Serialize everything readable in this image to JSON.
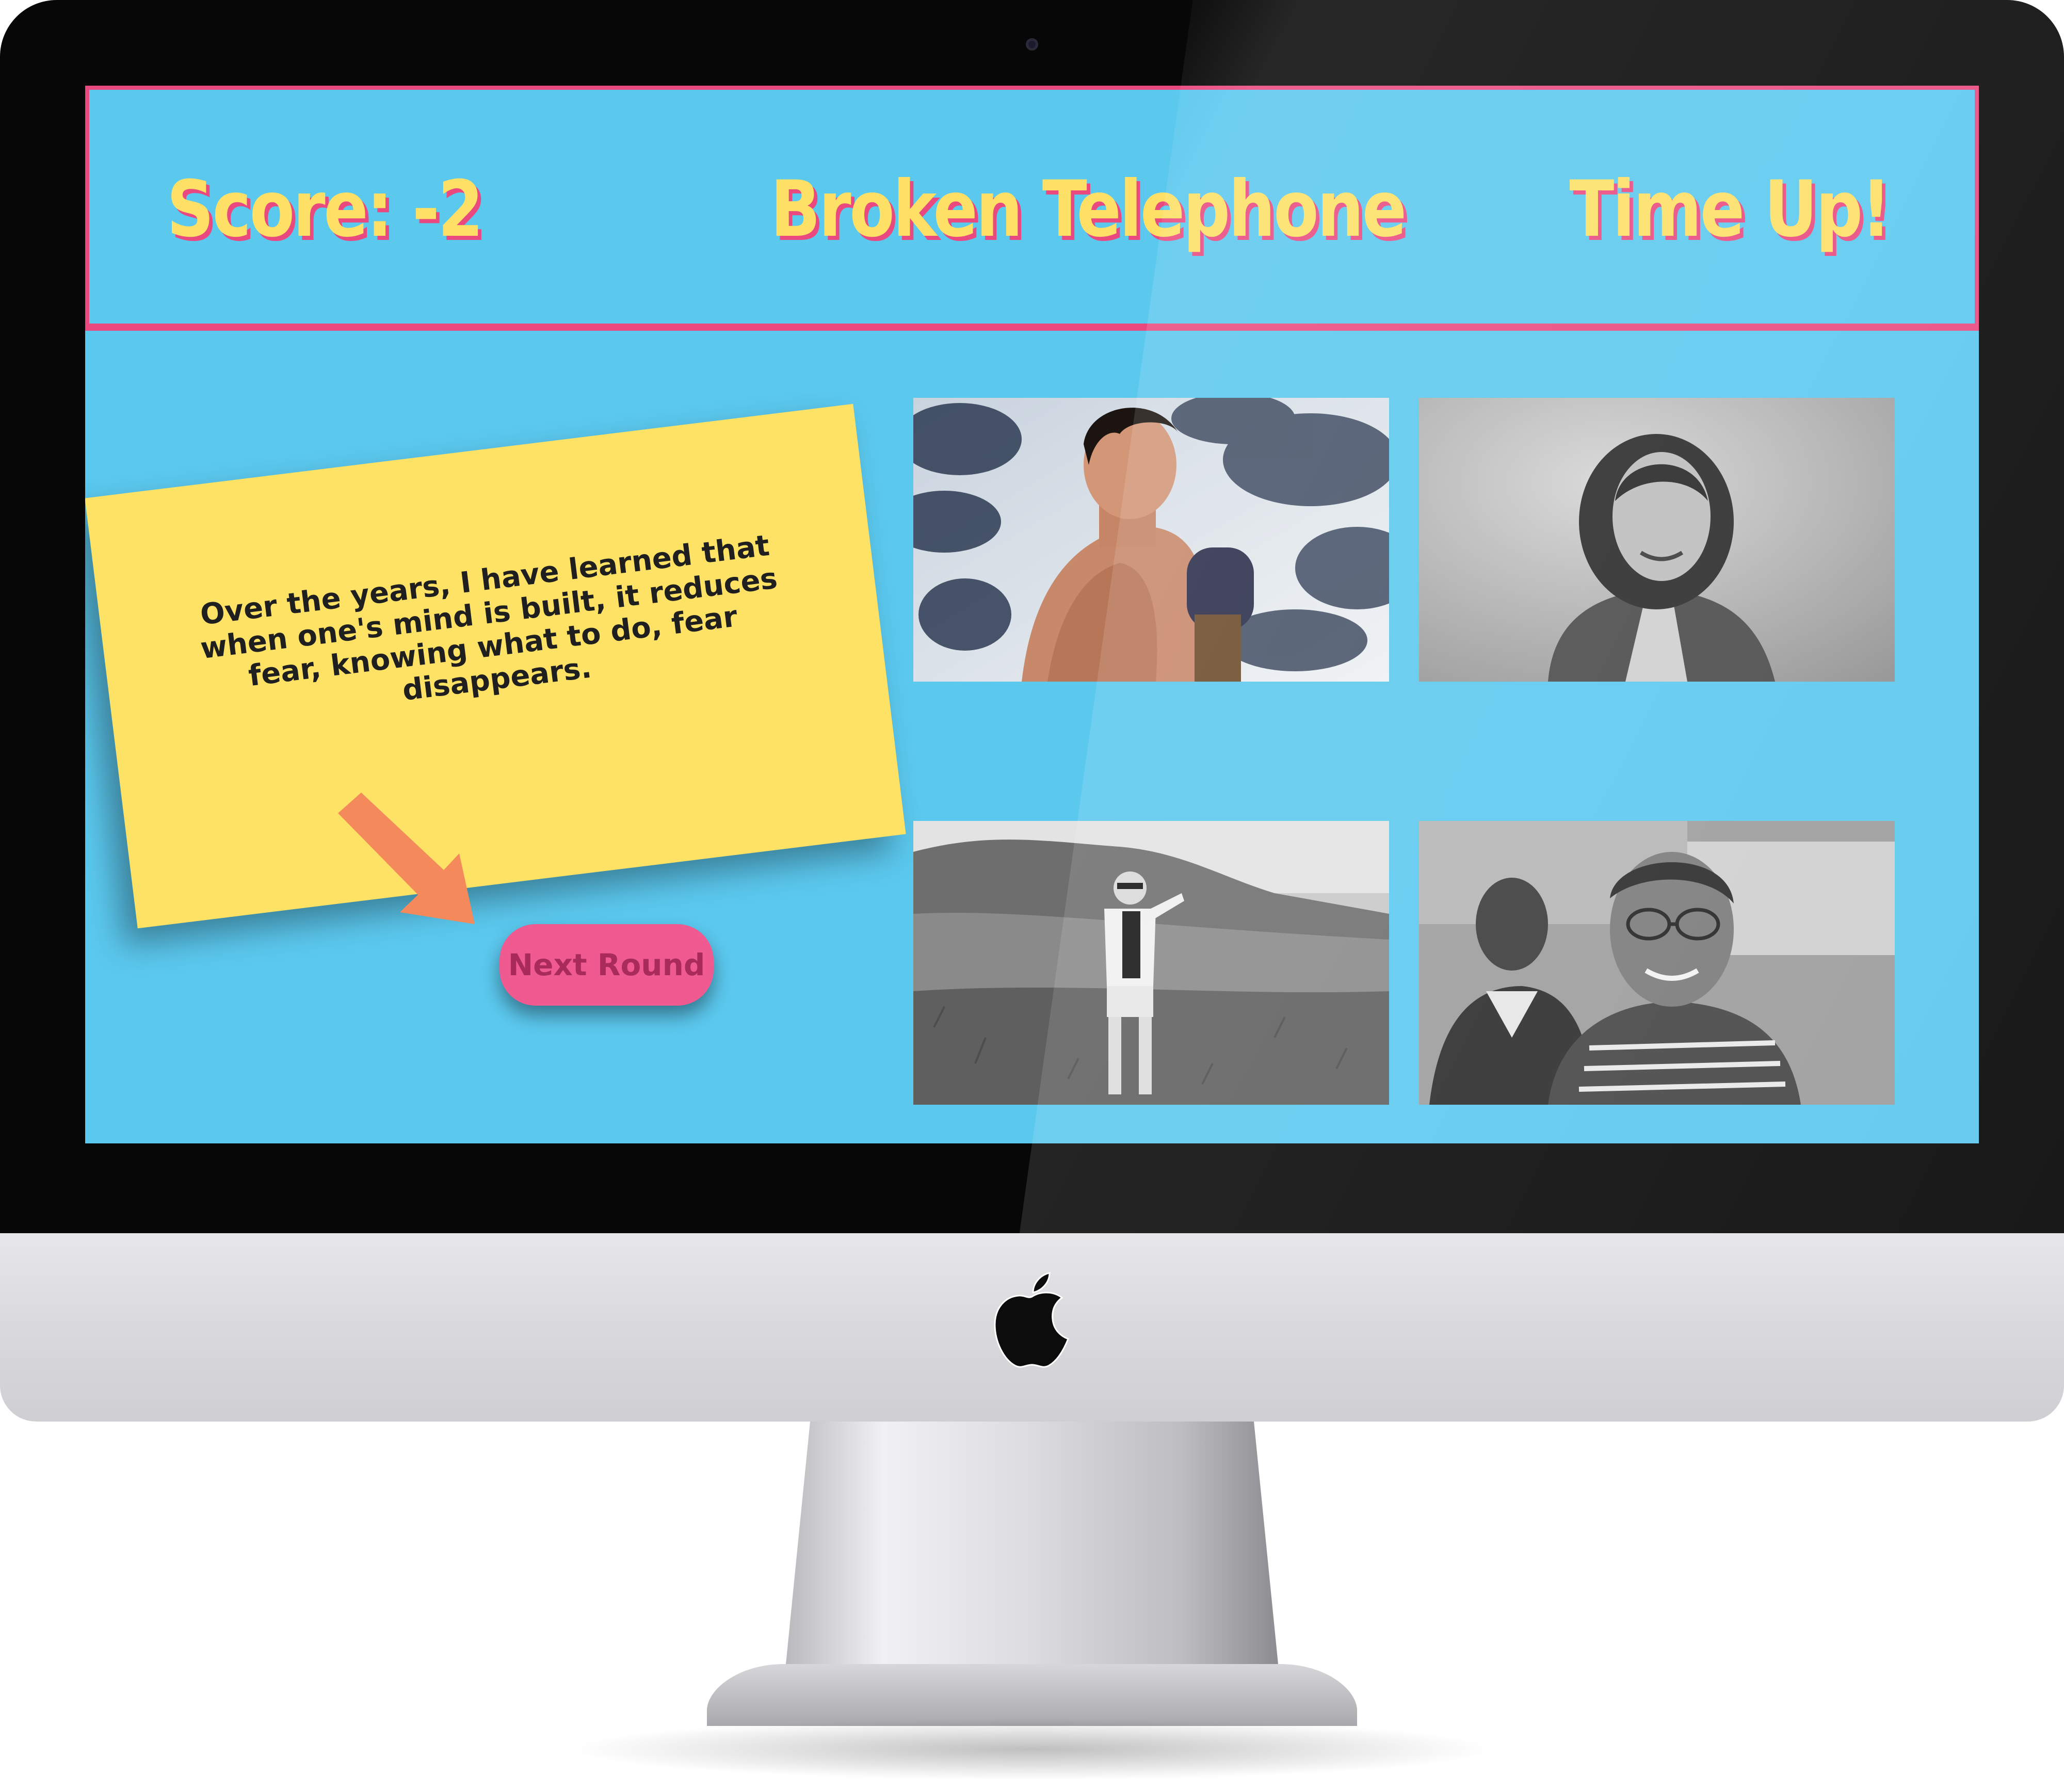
{
  "game": {
    "score_text": "Score: -2",
    "title": "Broken Telephone",
    "timer_text": "Time Up!",
    "quote": "Over the years, I have learned that when one's mind is built, it reduces fear, knowing what to do, fear disappears.",
    "next_button_label": "Next Round"
  },
  "colors": {
    "background": "#5bc8ee",
    "accent_pink": "#e9497f",
    "title_yellow": "#fde065",
    "note_yellow": "#fde265",
    "button_pink": "#ef5a91",
    "arrow_orange": "#f48a5b"
  },
  "photos": [
    {
      "name": "photo-option-1",
      "tone": "color"
    },
    {
      "name": "photo-option-2",
      "tone": "grayscale"
    },
    {
      "name": "photo-option-3",
      "tone": "grayscale"
    },
    {
      "name": "photo-option-4",
      "tone": "grayscale"
    }
  ],
  "icons": [
    "apple-logo-icon",
    "arrow-icon",
    "camera-icon"
  ]
}
